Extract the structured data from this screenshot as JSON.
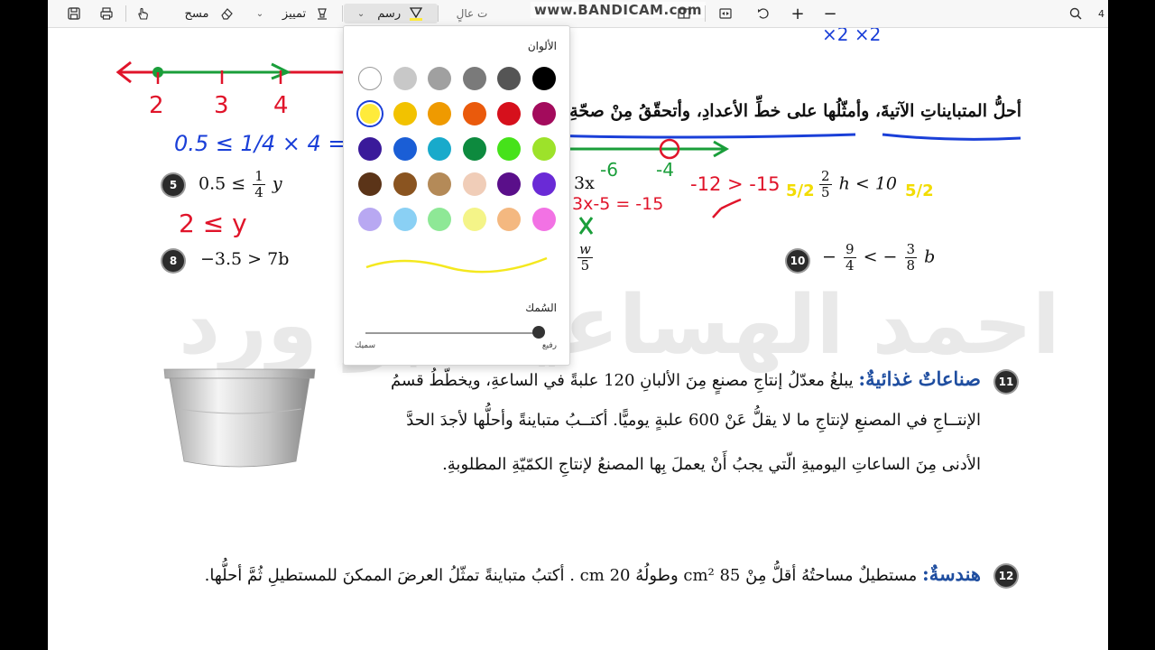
{
  "toolbar": {
    "draw_label": "رسم",
    "highlight_label": "تمييز",
    "erase_label": "مسح",
    "read_aloud_label": "ت عالٍ",
    "page_number": "4",
    "recorder_watermark": "www.BANDICAM.com"
  },
  "color_panel": {
    "title": "الألوان",
    "thickness_title": "السُمك",
    "thin_label": "رفيع",
    "thick_label": "سميك",
    "thickness_value": 1.0,
    "selected_color": "#ffeb3b",
    "colors": [
      [
        "#ffffff",
        "#c8c8c8",
        "#a0a0a0",
        "#7a7a7a",
        "#555555",
        "#000000"
      ],
      [
        "#ffeb3b",
        "#f2c200",
        "#ef9a00",
        "#ea5a0c",
        "#d6101c",
        "#a30b5c"
      ],
      [
        "#3a1a9a",
        "#1a5ed6",
        "#18aacb",
        "#0d8a3e",
        "#46e21a",
        "#9de22a"
      ],
      [
        "#5b3418",
        "#8a5420",
        "#b48a58",
        "#f0cdb8",
        "#5a0f8a",
        "#6a2ad6"
      ],
      [
        "#b8a8f2",
        "#8ad0f4",
        "#8ee896",
        "#f4f488",
        "#f4b880",
        "#f272e4"
      ]
    ]
  },
  "content": {
    "instruction": "أحلُّ المتبايناتِ الآتيةَ، وأمثّلُها على خطِّ الأعدادِ، وأتحقّقُ مِنْ صحّةِ الحلِّ:",
    "problems": {
      "p5": {
        "number": "5",
        "lhs": "0.5 ≤",
        "num": "1",
        "den": "4",
        "var": "y"
      },
      "p6": {
        "var": "3x"
      },
      "p7": {
        "num": "2",
        "den": "5",
        "rest": "h < 10"
      },
      "p8": {
        "number": "8",
        "expr": "−3.5 > 7b"
      },
      "p9": {
        "num": "w",
        "den": "5"
      },
      "p10": {
        "number": "10",
        "minus": "−",
        "num1": "9",
        "den1": "4",
        "mid": "< −",
        "num2": "3",
        "den2": "8",
        "var": "b"
      },
      "p11": {
        "number": "11",
        "heading": "صناعاتٌ غذائيةٌ:",
        "line1": "يبلغُ معدّلُ إنتاجِ مصنعٍ مِنَ الألبانِ 120 علبةً في الساعةِ، ويخطّطُ قسمُ",
        "line2": "الإنتــاجِ في المصنعِ لإنتاجِ ما لا يقلُّ عَنْ 600 علبةٍ يوميًّا. أكتــبُ متباينةً وأحلُّها لأجدَ الحدَّ",
        "line3": "الأدنى مِنَ الساعاتِ اليوميةِ الّتي يجبُ أَنْ يعملَ بِها المصنعُ لإنتاجِ الكمّيّةِ المطلوبةِ."
      },
      "p12": {
        "number": "12",
        "heading": "هندسةٌ:",
        "text": "مستطيلٌ مساحتُهُ أقلُّ مِنْ 85 cm² وطولُهُ 20 cm . أكتبُ متباينةً تمثّلُ العرضَ الممكنَ للمستطيلِ ثُمَّ أحلُّها."
      }
    },
    "watermark": "احمد الهساعيد ابو ورد"
  },
  "ink": {
    "red": "#e0142a",
    "green": "#1a9e3a",
    "blue": "#1a3fd8",
    "yellow": "#f4e81e",
    "number_line_labels": [
      "2",
      "3",
      "4"
    ],
    "p5_work": "0.5 ≤ 1/4 × 4 =",
    "p5_answer": "2 ≤ y",
    "p6_labels": [
      "-6",
      "-4"
    ],
    "p6_work": "3x-5 = -15",
    "p6_check": "-12 > -15",
    "p7_factor": "5/2",
    "top_marks": "×2   ×2"
  }
}
